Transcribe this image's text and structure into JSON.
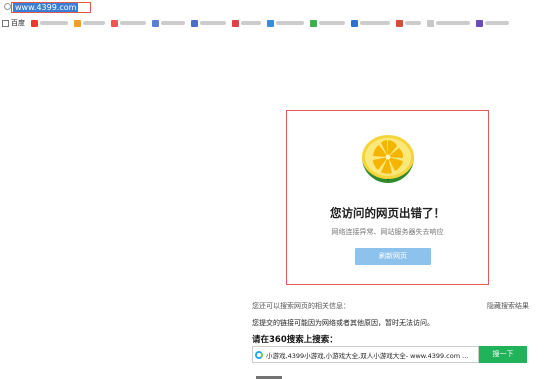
{
  "address_bar": {
    "url": "www.4399.com"
  },
  "bookmarks": {
    "first_label": "百度",
    "items": [
      {
        "icon": "red-bookmark-icon",
        "color": "#e53d2f"
      },
      {
        "icon": "orange-bookmark-icon",
        "color": "#f0a020"
      },
      {
        "icon": "red-circle-bookmark-icon",
        "color": "#e85a4f"
      },
      {
        "icon": "blue-bookmark-icon",
        "color": "#5a7fd8"
      },
      {
        "icon": "blue-bookmark-icon",
        "color": "#4a6fc8"
      },
      {
        "icon": "red-bookmark-icon",
        "color": "#e04040"
      },
      {
        "icon": "blue-bookmark-icon",
        "color": "#3c8ad8"
      },
      {
        "icon": "green-bookmark-icon",
        "color": "#3cb04a"
      },
      {
        "icon": "blue-bookmark-icon",
        "color": "#2f6fd0"
      },
      {
        "icon": "red-bookmark-icon",
        "color": "#d84a3a"
      },
      {
        "icon": "gray-bookmark-icon",
        "color": "#c8c8c8"
      },
      {
        "icon": "purple-bookmark-icon",
        "color": "#6a4ac0"
      }
    ]
  },
  "error": {
    "title": "您访问的网页出错了！",
    "subtitle": "网络连接异常、网站服务器失去响应",
    "refresh_label": "刷新网页",
    "illustration_icon": "lemon-slice-icon"
  },
  "lower": {
    "hint": "您还可以搜索网页的相关信息：",
    "hide_link": "隐藏搜索结果",
    "reason": "您提交的链接可能因为网络或者其他原因，暂时无法访问。",
    "search_label": "请在360搜索上搜索：",
    "search_value": "小游戏,4399小游戏,小游戏大全,双人小游戏大全- www.4399.com ...",
    "search_button": "搜一下"
  },
  "colors": {
    "error_border": "#e35a5a",
    "refresh_button": "#8cc2ec",
    "search_button": "#21b35a"
  }
}
